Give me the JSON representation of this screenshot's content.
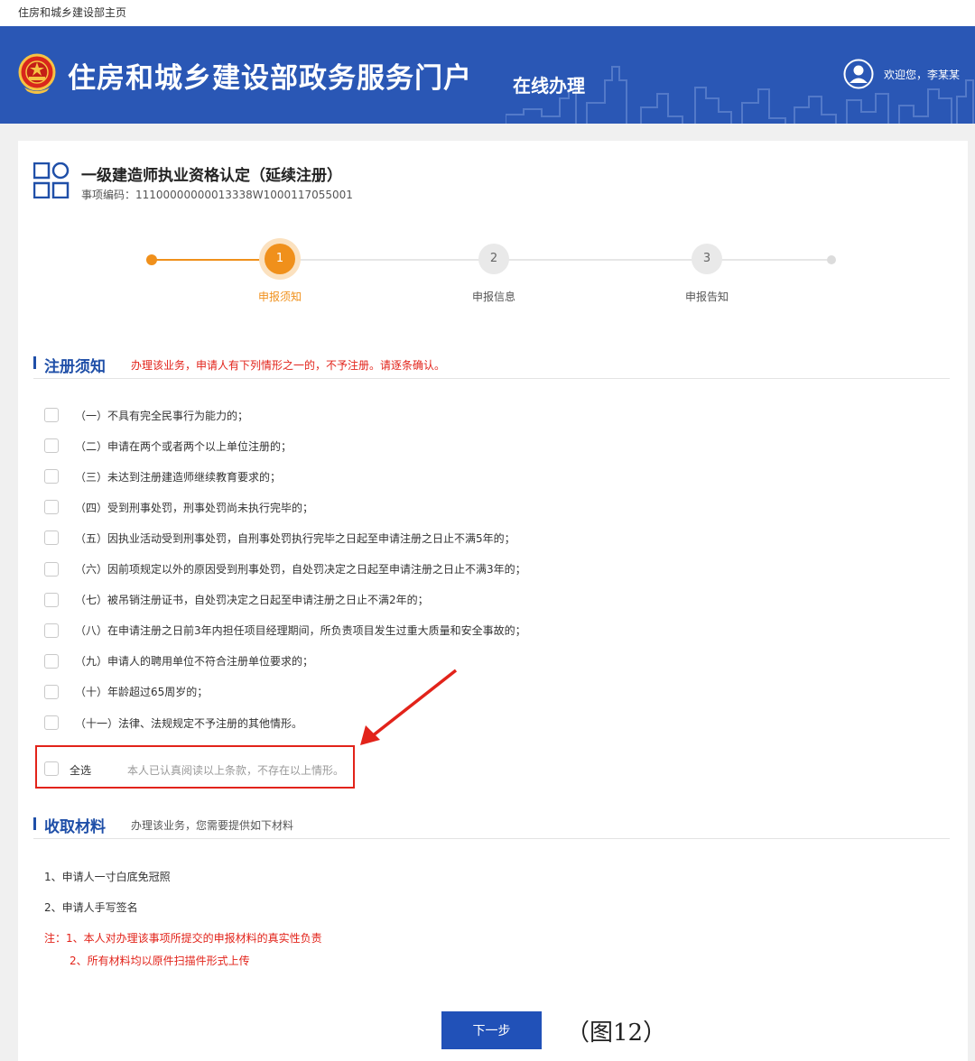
{
  "top_link": "住房和城乡建设部主页",
  "header": {
    "title": "住房和城乡建设部政务服务门户",
    "subtitle": "在线办理",
    "welcome": "欢迎您，李某某"
  },
  "service": {
    "title": "一级建造师执业资格认定（延续注册）",
    "code": "事项编码：11100000000013338W1000117055001"
  },
  "steps": [
    {
      "num": "1",
      "label": "申报须知"
    },
    {
      "num": "2",
      "label": "申报信息"
    },
    {
      "num": "3",
      "label": "申报告知"
    }
  ],
  "notice": {
    "title": "注册须知",
    "note": "办理该业务，申请人有下列情形之一的，不予注册。请逐条确认。",
    "items": [
      "（一）不具有完全民事行为能力的；",
      "（二）申请在两个或者两个以上单位注册的；",
      "（三）未达到注册建造师继续教育要求的；",
      "（四）受到刑事处罚，刑事处罚尚未执行完毕的；",
      "（五）因执业活动受到刑事处罚，自刑事处罚执行完毕之日起至申请注册之日止不满5年的；",
      "（六）因前项规定以外的原因受到刑事处罚，自处罚决定之日起至申请注册之日止不满3年的；",
      "（七）被吊销注册证书，自处罚决定之日起至申请注册之日止不满2年的；",
      "（八）在申请注册之日前3年内担任项目经理期间，所负责项目发生过重大质量和安全事故的；",
      "（九）申请人的聘用单位不符合注册单位要求的；",
      "（十）年龄超过65周岁的；",
      "（十一）法律、法规规定不予注册的其他情形。"
    ],
    "select_all": "全选",
    "select_all_hint": "本人已认真阅读以上条款，不存在以上情形。"
  },
  "materials": {
    "title": "收取材料",
    "note": "办理该业务，您需要提供如下材料",
    "items": [
      "1、申请人一寸白底免冠照",
      "2、申请人手写签名"
    ],
    "notes": [
      "注：1、本人对办理该事项所提交的申报材料的真实性负责",
      "2、所有材料均以原件扫描件形式上传"
    ]
  },
  "next_button": "下一步",
  "caption": "（图12）",
  "colors": {
    "primary": "#2a57b5",
    "accent": "#f0901b",
    "alert": "#e2231a"
  }
}
